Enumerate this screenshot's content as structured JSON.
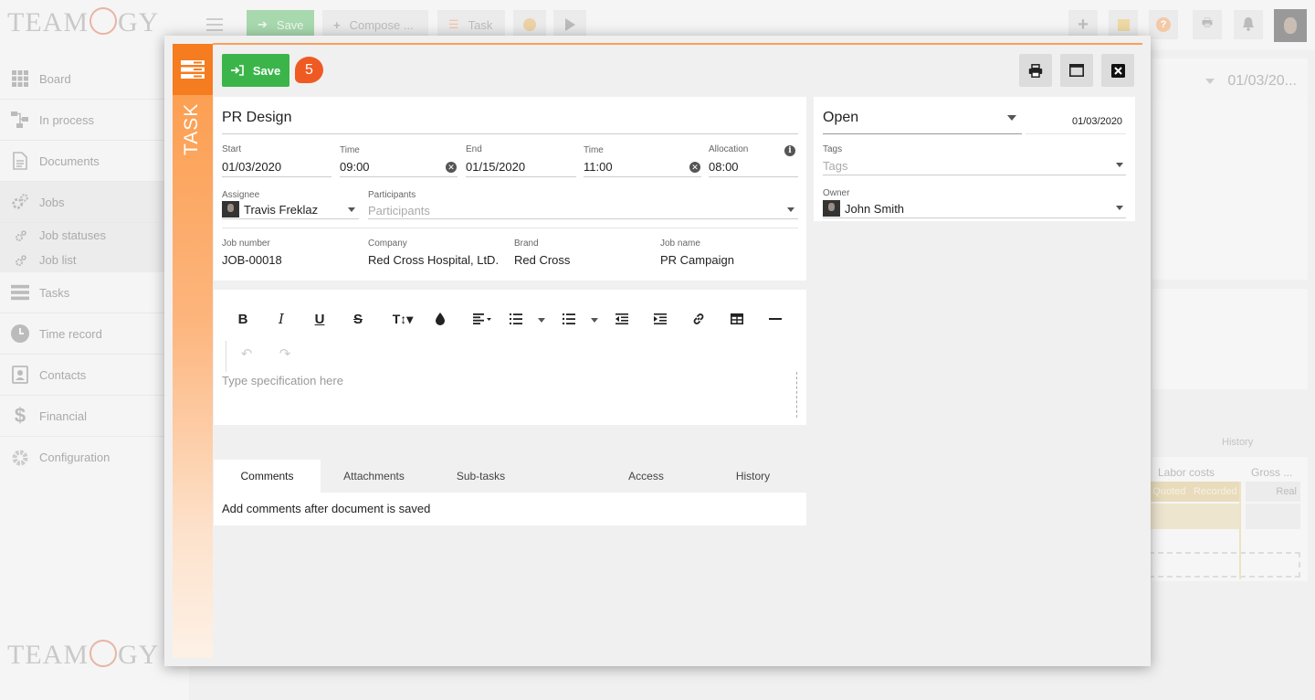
{
  "app": {
    "logo_text": "TEAMOGY",
    "topbar": {
      "save_label": "Save",
      "compose_label": "Compose ...",
      "task_label": "Task"
    },
    "nav": [
      {
        "label": "Board",
        "icon": "grid-icon"
      },
      {
        "label": "In process",
        "icon": "flow-icon"
      },
      {
        "label": "Documents",
        "icon": "document-icon"
      },
      {
        "label": "Jobs",
        "icon": "gears-icon"
      },
      {
        "label": "Job statuses",
        "icon": "small-gears-icon"
      },
      {
        "label": "Job list",
        "icon": "small-gears-icon"
      },
      {
        "label": "Tasks",
        "icon": "tasks-icon"
      },
      {
        "label": "Time record",
        "icon": "clock-icon"
      },
      {
        "label": "Contacts",
        "icon": "contact-book-icon"
      },
      {
        "label": "Financial",
        "icon": "dollar-icon"
      },
      {
        "label": "Configuration",
        "icon": "gear-icon"
      }
    ],
    "background_panel": {
      "date": "01/03/20...",
      "history_label": "History",
      "labor_costs": "Labor costs",
      "gross": "Gross ...",
      "quoted": "Quoted",
      "recorded": "Recorded",
      "real": "Real"
    }
  },
  "modal": {
    "side_label": "TASK",
    "save_label": "Save",
    "badge_count": "5",
    "title": "PR Design",
    "start": {
      "label": "Start",
      "value": "01/03/2020"
    },
    "start_time": {
      "label": "Time",
      "value": "09:00"
    },
    "end": {
      "label": "End",
      "value": "01/15/2020"
    },
    "end_time": {
      "label": "Time",
      "value": "11:00"
    },
    "allocation": {
      "label": "Allocation",
      "value": "08:00"
    },
    "assignee": {
      "label": "Assignee",
      "value": "Travis Freklaz"
    },
    "participants": {
      "label": "Participants",
      "placeholder": "Participants"
    },
    "job_number": {
      "label": "Job number",
      "value": "JOB-00018"
    },
    "company": {
      "label": "Company",
      "value": "Red Cross Hospital, LtD."
    },
    "brand": {
      "label": "Brand",
      "value": "Red Cross"
    },
    "job_name": {
      "label": "Job name",
      "value": "PR Campaign"
    },
    "status": {
      "value": "Open",
      "date": "01/03/2020"
    },
    "tags": {
      "label": "Tags",
      "placeholder": "Tags"
    },
    "owner": {
      "label": "Owner",
      "value": "John Smith"
    },
    "editor": {
      "placeholder": "Type specification here"
    },
    "tabs": [
      {
        "label": "Comments",
        "active": true
      },
      {
        "label": "Attachments",
        "active": false
      },
      {
        "label": "Sub-tasks",
        "active": false
      },
      {
        "label": "Access",
        "active": false
      },
      {
        "label": "History",
        "active": false
      }
    ],
    "comments_text": "Add comments after document is saved"
  },
  "colors": {
    "accent_orange": "#f57c1f",
    "save_green": "#3bb549",
    "badge_red": "#ef5a23"
  }
}
